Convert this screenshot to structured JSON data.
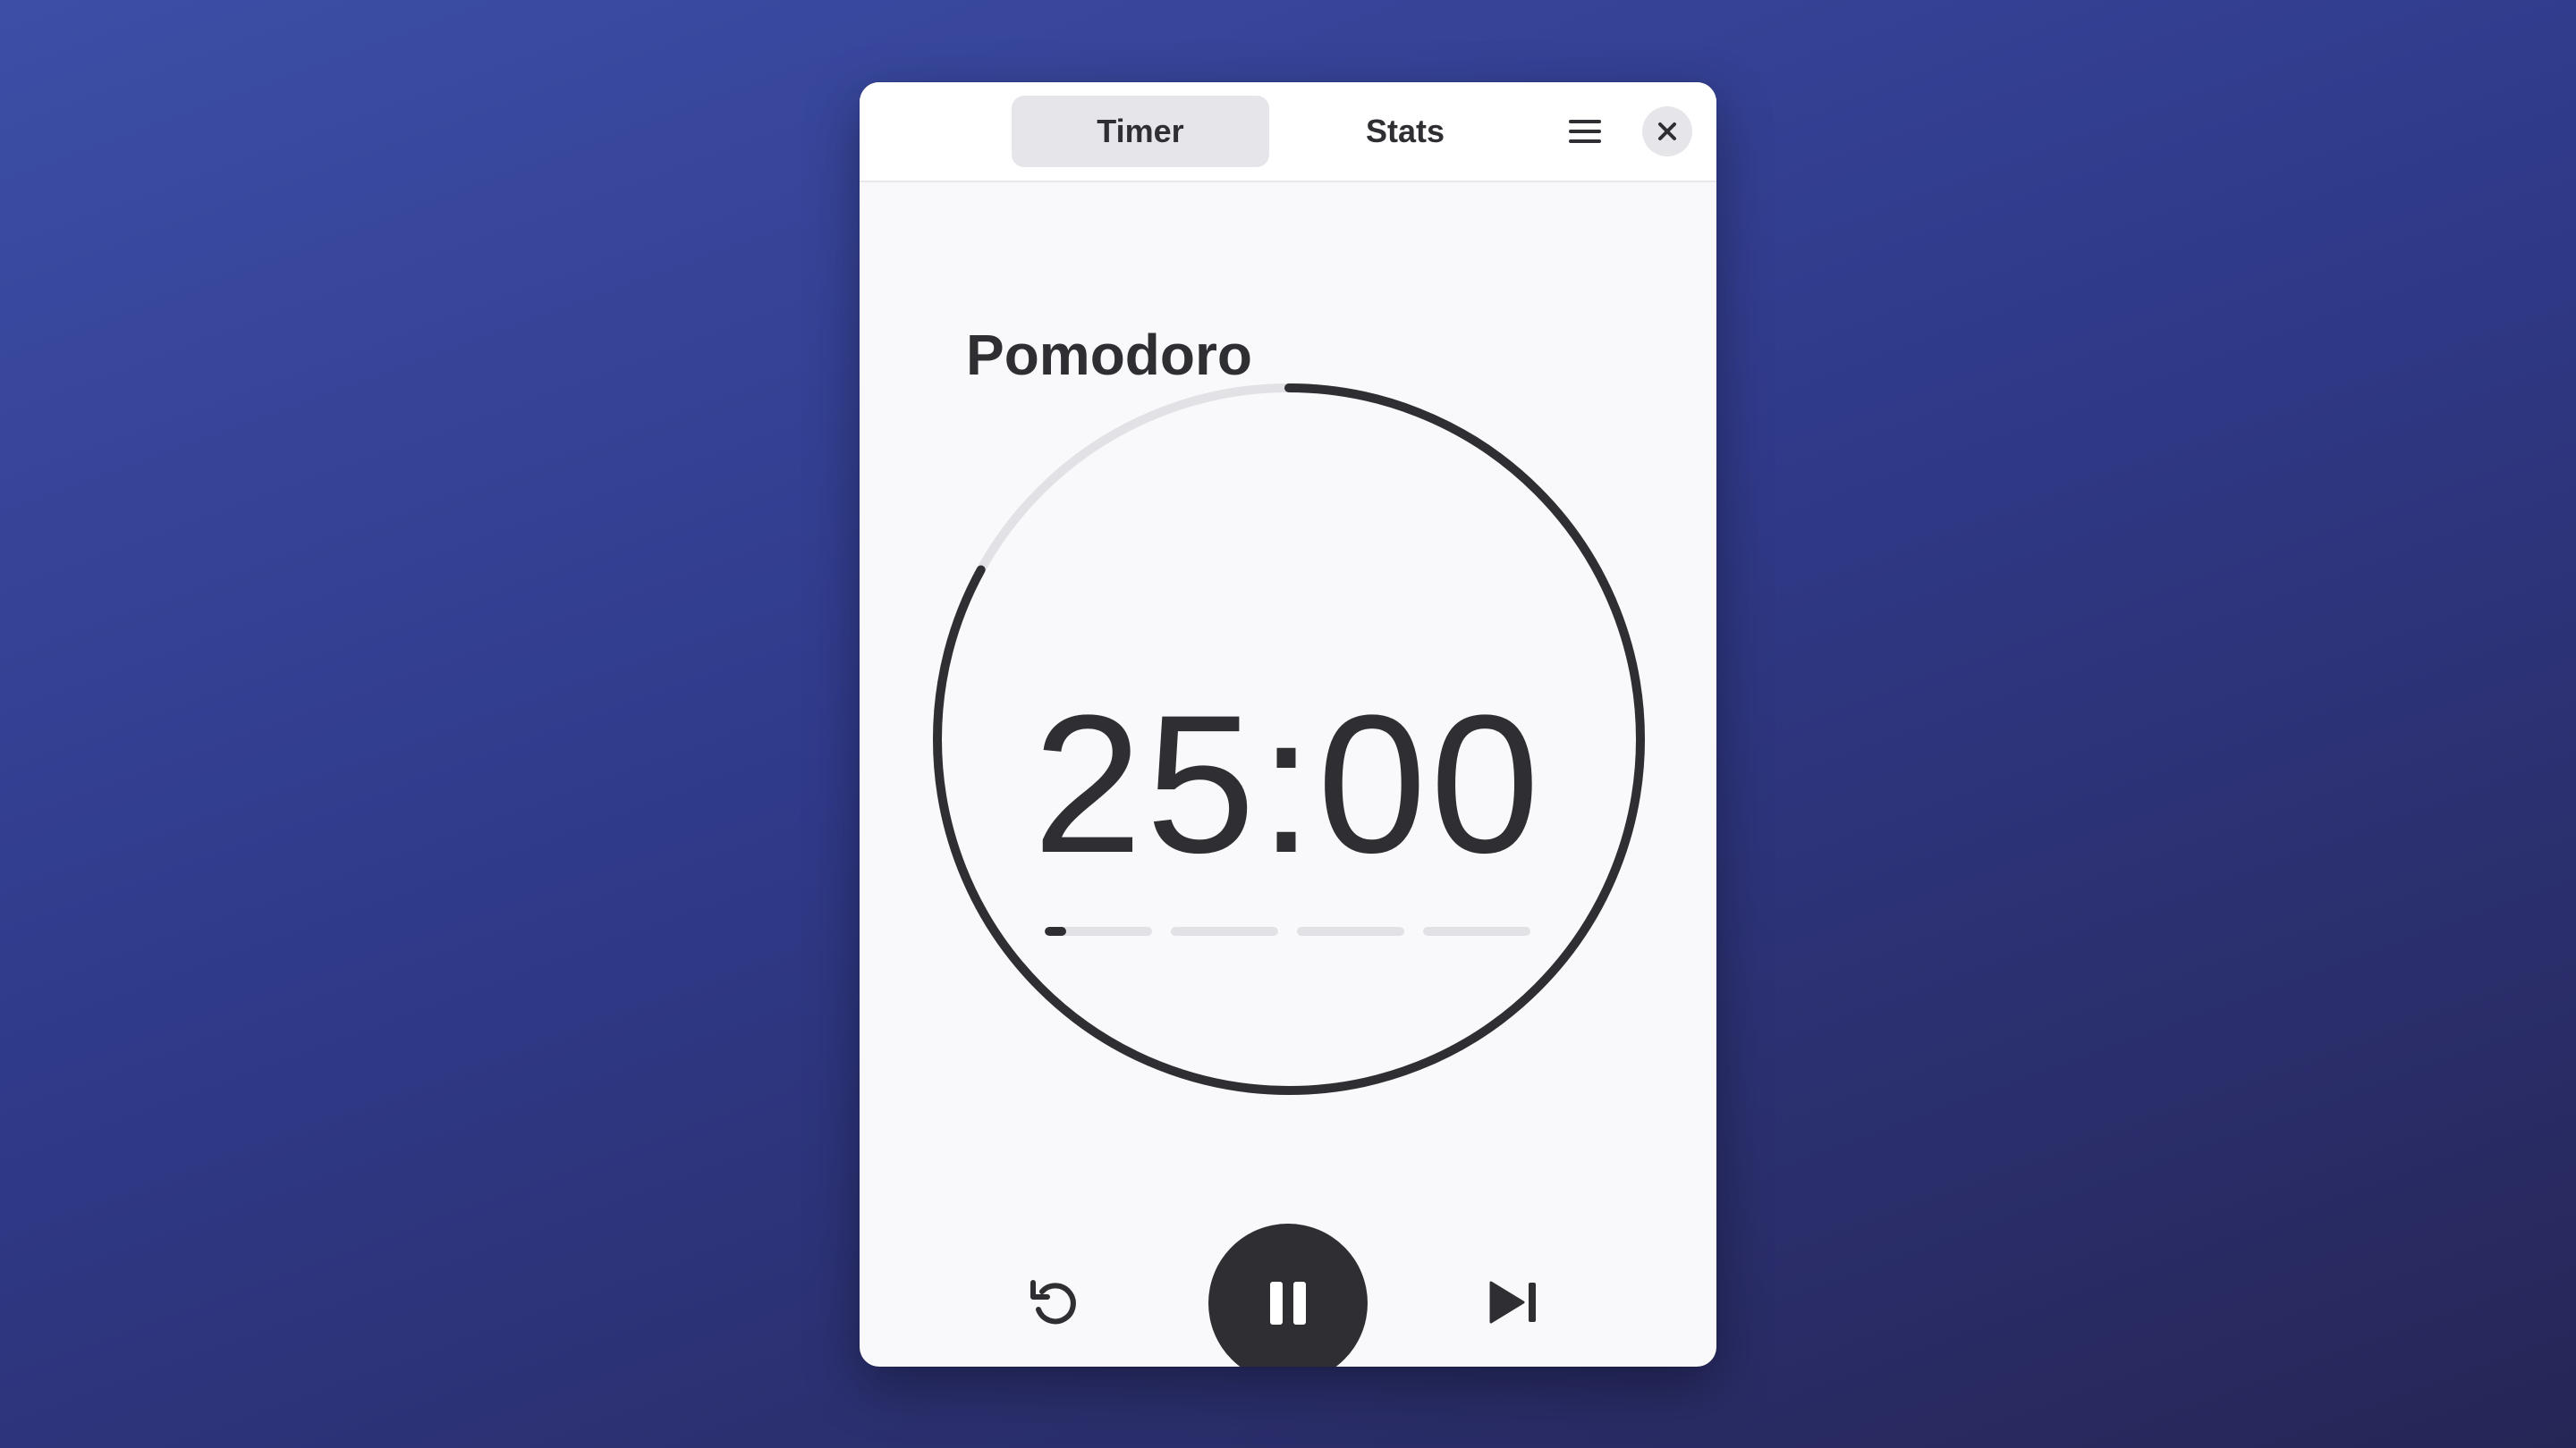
{
  "header": {
    "tabs": [
      {
        "label": "Timer",
        "active": true
      },
      {
        "label": "Stats",
        "active": false
      }
    ],
    "menu_icon": "hamburger-menu-icon",
    "close_icon": "close-icon"
  },
  "main": {
    "title": "Pomodoro",
    "time": "25:00",
    "ring_progress": 0.83,
    "sessions": [
      {
        "progress": 0.2
      },
      {
        "progress": 0
      },
      {
        "progress": 0
      },
      {
        "progress": 0
      }
    ]
  },
  "controls": {
    "reset_icon": "reset-icon",
    "pause_icon": "pause-icon",
    "skip_icon": "skip-next-icon"
  },
  "colors": {
    "accent": "#2e2e33",
    "track": "#e2e2e6",
    "background_top": "#3c4ea6",
    "background_bottom": "#262656"
  }
}
